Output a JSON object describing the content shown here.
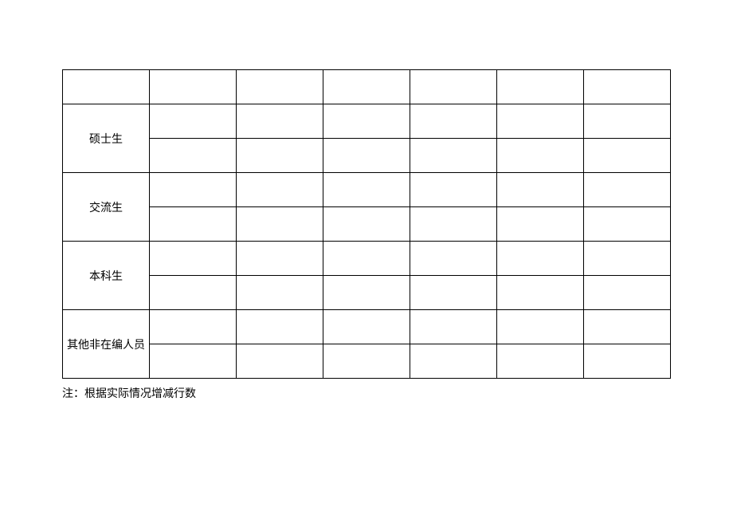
{
  "table": {
    "rows": [
      {
        "label": "",
        "span": 1
      },
      {
        "label": "硕士生",
        "span": 2
      },
      {
        "label": "交流生",
        "span": 2
      },
      {
        "label": "本科生",
        "span": 2
      },
      {
        "label": "其他非在编人员",
        "span": 2
      }
    ]
  },
  "note": "注：根据实际情况增减行数"
}
